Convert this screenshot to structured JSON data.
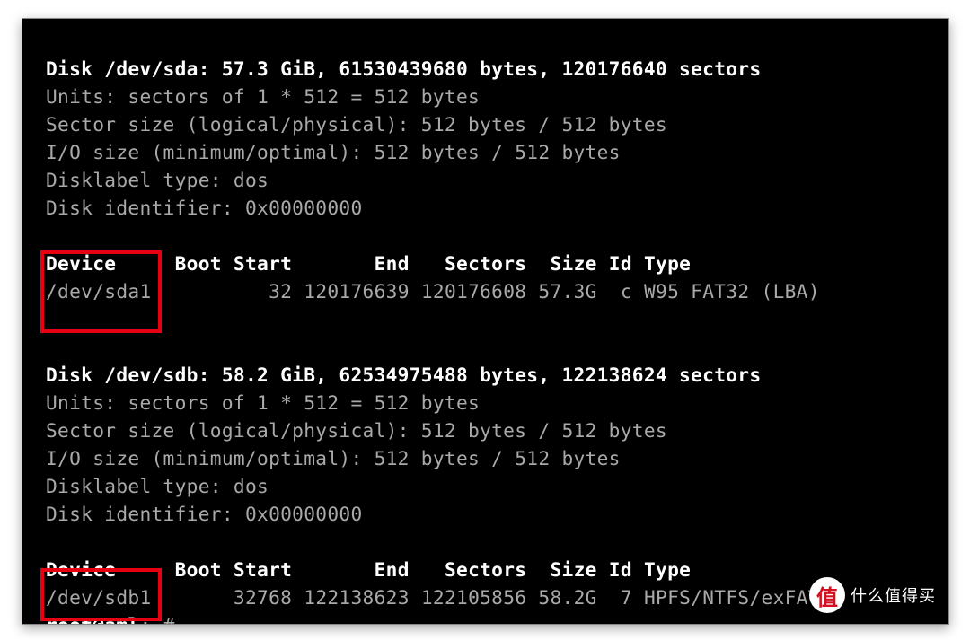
{
  "disk_a": {
    "header": "Disk /dev/sda: 57.3 GiB, 61530439680 bytes, 120176640 sectors",
    "units": "Units: sectors of 1 * 512 = 512 bytes",
    "sector_size": "Sector size (logical/physical): 512 bytes / 512 bytes",
    "io_size": "I/O size (minimum/optimal): 512 bytes / 512 bytes",
    "label_type": "Disklabel type: dos",
    "identifier": "Disk identifier: 0x00000000",
    "table_header": {
      "device": "Device",
      "boot": "Boot",
      "start": "Start",
      "end": "End",
      "sectors": "Sectors",
      "size": "Size",
      "id": "Id",
      "type": "Type"
    },
    "partition": {
      "device": "/dev/sda1",
      "boot": "",
      "start": "32",
      "end": "120176639",
      "sectors": "120176608",
      "size": "57.3G",
      "id": "c",
      "type": "W95 FAT32 (LBA)"
    }
  },
  "disk_b": {
    "header": "Disk /dev/sdb: 58.2 GiB, 62534975488 bytes, 122138624 sectors",
    "units": "Units: sectors of 1 * 512 = 512 bytes",
    "sector_size": "Sector size (logical/physical): 512 bytes / 512 bytes",
    "io_size": "I/O size (minimum/optimal): 512 bytes / 512 bytes",
    "label_type": "Disklabel type: dos",
    "identifier": "Disk identifier: 0x00000000",
    "table_header": {
      "device": "Device",
      "boot": "Boot",
      "start": "Start",
      "end": "End",
      "sectors": "Sectors",
      "size": "Size",
      "id": "Id",
      "type": "Type"
    },
    "partition": {
      "device": "/dev/sdb1",
      "boot": "",
      "start": "32768",
      "end": "122138623",
      "sectors": "122105856",
      "size": "58.2G",
      "id": "7",
      "type": "HPFS/NTFS/exFAT"
    }
  },
  "prompt": {
    "user_host": "root@aml",
    "cwd_sym": ":~#",
    "suffix": " "
  },
  "watermark": {
    "logo": "值",
    "text": "什么值得买"
  }
}
